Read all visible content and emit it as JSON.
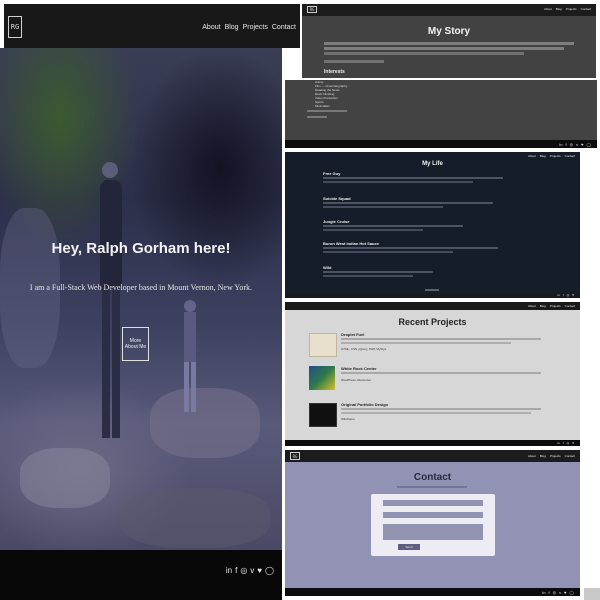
{
  "hero": {
    "logo": "RG",
    "nav": [
      "About",
      "Blog",
      "Projects",
      "Contact"
    ],
    "headline": "Hey, Ralph Gorham here!",
    "subheadline": "I am a Full-Stack Web Developer based in Mount Vernon, New York.",
    "cta": "More About Me",
    "social_icons": [
      "linkedin-icon",
      "facebook-icon",
      "instagram-icon",
      "vimeo-icon",
      "twitter-icon",
      "github-icon"
    ],
    "social_glyphs": [
      "in",
      "f",
      "◎",
      "v",
      "♥",
      "◯"
    ]
  },
  "story": {
    "logo": "RG",
    "nav": [
      "About",
      "Blog",
      "Projects",
      "Contact"
    ],
    "title": "My Story",
    "interests_heading": "Interests",
    "interests_items": [
      "Hiking",
      "Film — Cinematography",
      "Reading the News",
      "Rock Climbing",
      "Video Production",
      "Sports",
      "Minimalism"
    ]
  },
  "life": {
    "nav": [
      "About",
      "Blog",
      "Projects",
      "Contact"
    ],
    "title": "My Life",
    "posts": [
      {
        "title": "Free Guy"
      },
      {
        "title": "Suicide Squad"
      },
      {
        "title": "Jungle Cruise"
      },
      {
        "title": "Buron West Indian Hot Sauce"
      },
      {
        "title": "Wild"
      }
    ]
  },
  "projects": {
    "title": "Recent Projects",
    "items": [
      {
        "title": "Droplet Fuel",
        "tags": "HTML, CSS, jQuery, PHP, MySQL",
        "thumb_color": "#e8e0cc"
      },
      {
        "title": "White Rock Center",
        "tags": "WordPress, Elementor",
        "thumb_color": "#2f6a4a"
      },
      {
        "title": "Original Portfolio Design",
        "tags": "Wireframe",
        "thumb_color": "#101010"
      }
    ]
  },
  "contact": {
    "logo": "RG",
    "nav": [
      "About",
      "Blog",
      "Projects",
      "Contact"
    ],
    "title": "Contact",
    "submit": "Send"
  }
}
